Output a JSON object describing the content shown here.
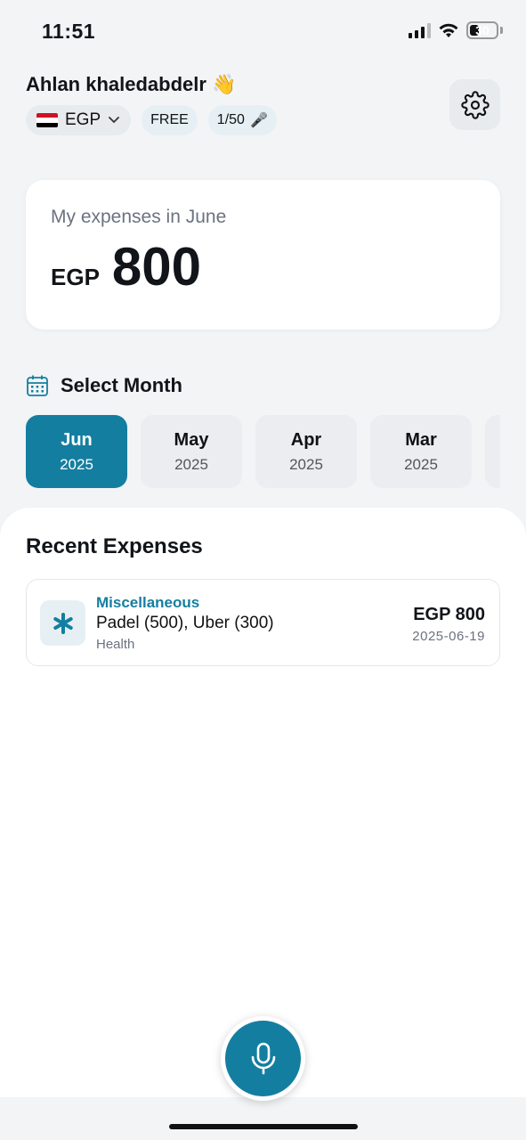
{
  "status_bar": {
    "time": "11:51",
    "battery": "30"
  },
  "header": {
    "greeting": "Ahlan khaledabdelr",
    "greeting_emoji": "👋",
    "currency": "EGP",
    "plan": "FREE",
    "usage": "1/50",
    "usage_emoji": "🎤",
    "settings_icon": "gear-icon"
  },
  "summary": {
    "label": "My expenses in June",
    "currency": "EGP",
    "amount": "800"
  },
  "month_picker": {
    "title": "Select Month",
    "months": [
      {
        "month": "Jun",
        "year": "2025",
        "active": true
      },
      {
        "month": "May",
        "year": "2025",
        "active": false
      },
      {
        "month": "Apr",
        "year": "2025",
        "active": false
      },
      {
        "month": "Mar",
        "year": "2025",
        "active": false
      }
    ]
  },
  "recent": {
    "title": "Recent Expenses",
    "items": [
      {
        "category": "Miscellaneous",
        "description": "Padel (500), Uber (300)",
        "tag": "Health",
        "amount": "EGP 800",
        "date": "2025-06-19",
        "icon": "asterisk-icon"
      }
    ]
  },
  "colors": {
    "accent": "#147ea1",
    "background": "#f2f4f6",
    "card": "#ffffff"
  }
}
